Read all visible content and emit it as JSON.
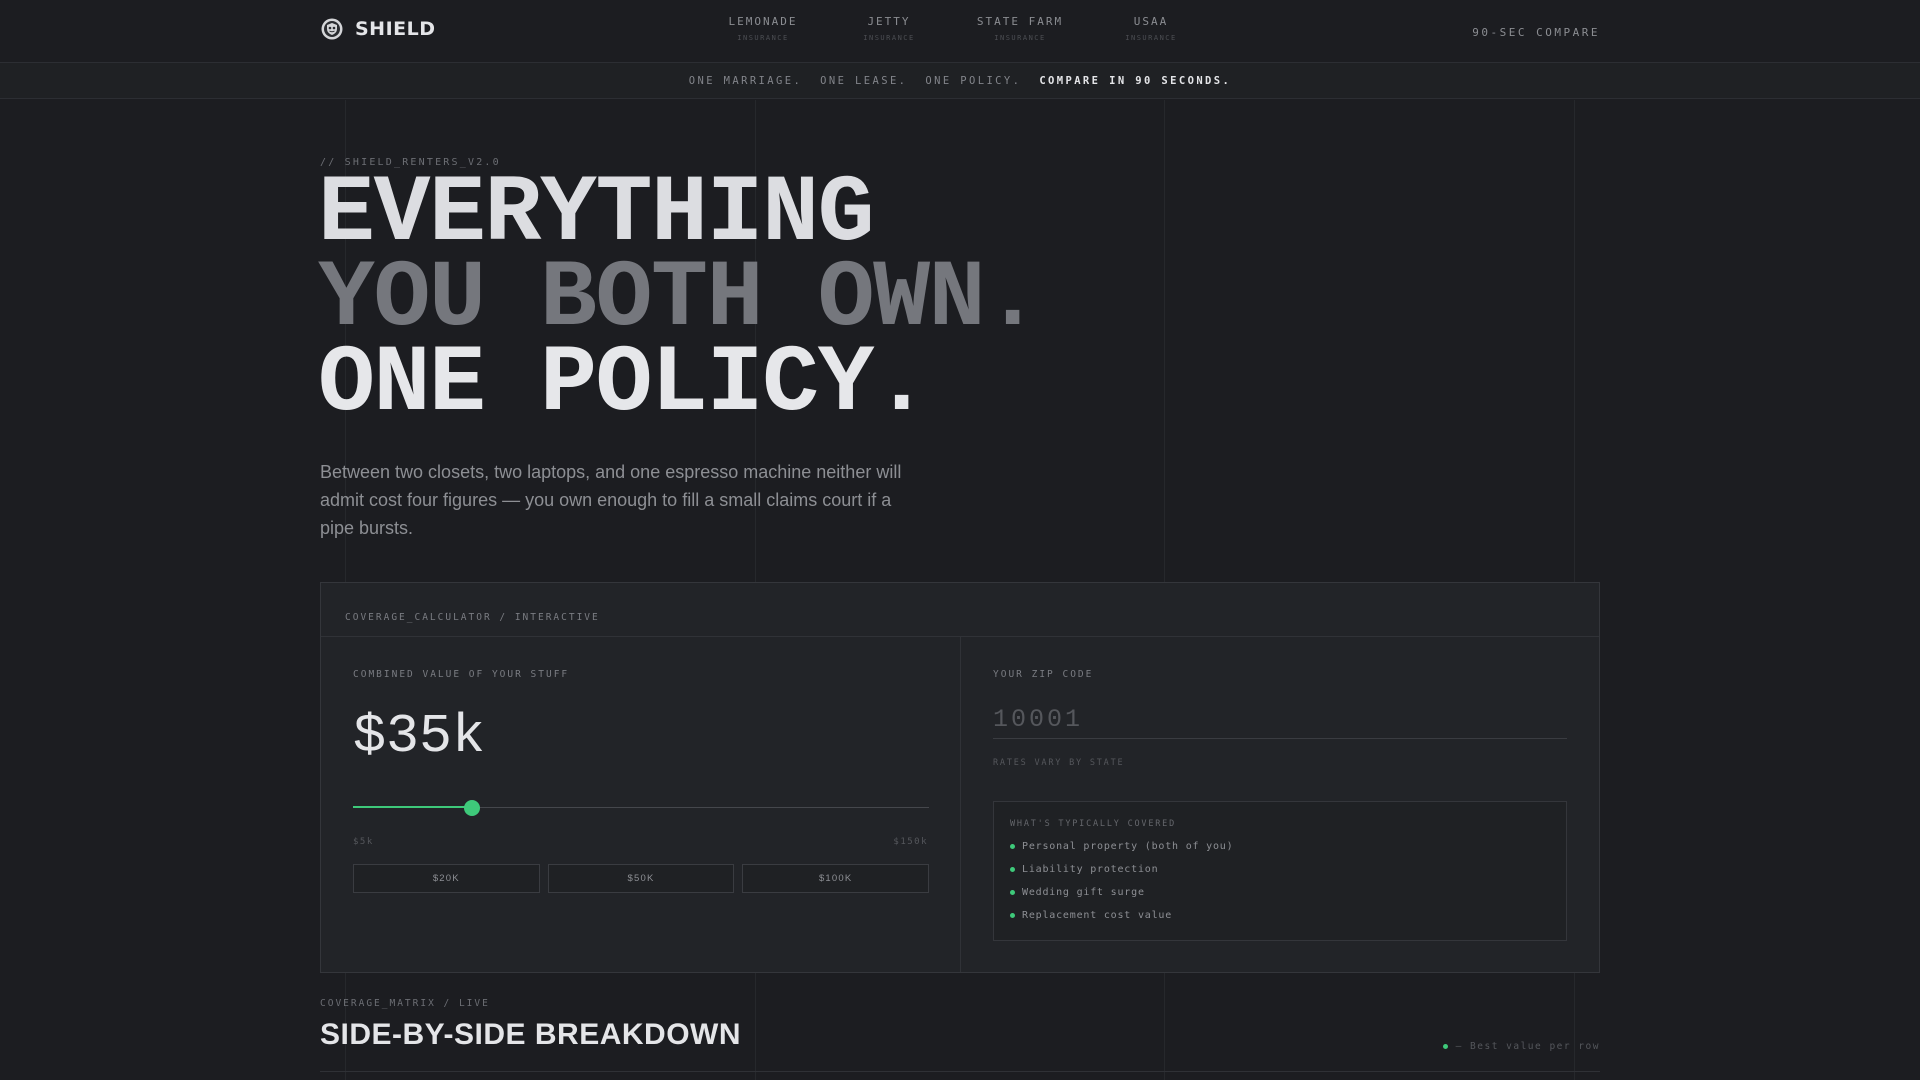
{
  "brand": {
    "name": "SHIELD",
    "icon": "shield-logo-icon"
  },
  "nav": {
    "providers": [
      {
        "name": "LEMONADE",
        "sub": "INSURANCE"
      },
      {
        "name": "JETTY",
        "sub": "INSURANCE"
      },
      {
        "name": "STATE FARM",
        "sub": "INSURANCE"
      },
      {
        "name": "USAA",
        "sub": "INSURANCE"
      }
    ],
    "compare_label": "90-SEC COMPARE"
  },
  "tagline": {
    "part1": "ONE MARRIAGE.",
    "part2": "ONE LEASE.",
    "part3": "ONE POLICY.",
    "highlight": "COMPARE IN 90 SECONDS."
  },
  "hero": {
    "eyebrow": "// SHIELD_RENTERS_V2.0",
    "line1": "EVERYTHING",
    "line2": "YOU BOTH OWN.",
    "line3": "ONE POLICY.",
    "intro": "Between two closets, two laptops, and one espresso machine neither will admit cost four figures — you own enough to fill a small claims court if a pipe bursts."
  },
  "calculator": {
    "header": "COVERAGE_CALCULATOR / INTERACTIVE",
    "value_label": "COMBINED VALUE OF YOUR STUFF",
    "value_display": "$35k",
    "slider": {
      "min": 5,
      "max": 150,
      "value": 35,
      "unit": "k"
    },
    "range_min": "$5k",
    "range_max": "$150k",
    "presets": [
      "$20K",
      "$50K",
      "$100K"
    ],
    "zip_label": "YOUR ZIP CODE",
    "zip_placeholder": "10001",
    "zip_value": "",
    "rates_note": "RATES VARY BY STATE",
    "covered_title": "WHAT'S TYPICALLY COVERED",
    "covered_items": [
      "Personal property (both of you)",
      "Liability protection",
      "Wedding gift surge",
      "Replacement cost value"
    ]
  },
  "matrix": {
    "eyebrow": "COVERAGE_MATRIX / LIVE",
    "title": "SIDE-BY-SIDE BREAKDOWN",
    "legend": "— Best value per row"
  },
  "colors": {
    "background": "#1c1d21",
    "panel": "#222428",
    "accent": "#3ec97a",
    "text": "#e4e5e8",
    "muted": "#8d8f94"
  }
}
